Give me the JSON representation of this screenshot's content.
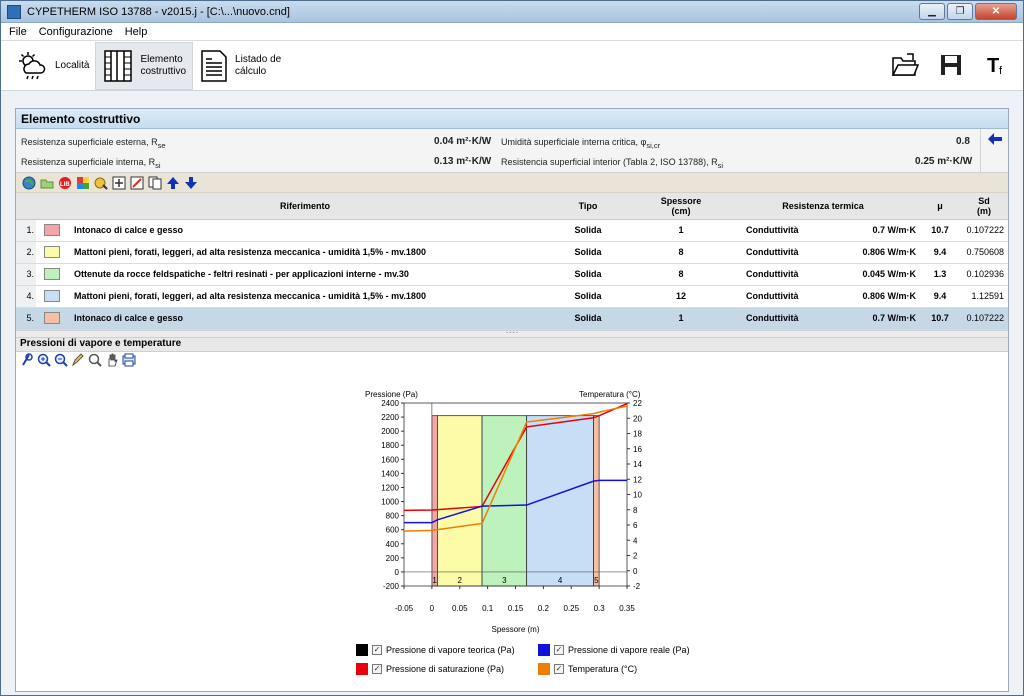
{
  "window": {
    "title": "CYPETHERM ISO 13788 - v2015.j - [C:\\...\\nuovo.cnd]"
  },
  "menu": [
    "File",
    "Configurazione",
    "Help"
  ],
  "toolbar": {
    "localita": "Località",
    "elemento_l1": "Elemento",
    "elemento_l2": "costruttivo",
    "listado_l1": "Listado de",
    "listado_l2": "cálculo"
  },
  "section_title": "Elemento costruttivo",
  "props": {
    "rse_label": "Resistenza superficiale esterna, R",
    "rse_sub": "se",
    "rse_value": "0.04 m²·K/W",
    "rsi_label": "Resistenza superficiale interna, R",
    "rsi_sub": "si",
    "rsi_value": "0.13 m²·K/W",
    "umid_label": "Umidità superficiale interna critica, φ",
    "umid_sub": "si,cr",
    "umid_value": "0.8",
    "res_int_label": "Resistencia superficial interior (Tabla 2, ISO 13788), R",
    "res_int_sub": "si",
    "res_int_value": "0.25 m²·K/W"
  },
  "table": {
    "headers": {
      "riferimento": "Riferimento",
      "tipo": "Tipo",
      "spessore": "Spessore",
      "spessore_unit": "(cm)",
      "resistenza": "Resistenza termica",
      "mu": "μ",
      "sd": "Sd",
      "sd_unit": "(m)"
    },
    "rows": [
      {
        "n": "1.",
        "color": "#f4a6a6",
        "ref": "Intonaco di calce e gesso",
        "tipo": "Solida",
        "spessore": "1",
        "res_type": "Conduttività",
        "res_val": "0.7 W/m·K",
        "mu": "10.7",
        "sd": "0.107222"
      },
      {
        "n": "2.",
        "color": "#fcfca8",
        "ref": "Mattoni pieni, forati, leggeri, ad alta resistenza meccanica - umidità 1,5% - mv.1800",
        "tipo": "Solida",
        "spessore": "8",
        "res_type": "Conduttività",
        "res_val": "0.806 W/m·K",
        "mu": "9.4",
        "sd": "0.750608"
      },
      {
        "n": "3.",
        "color": "#bdf2bd",
        "ref": "Ottenute da rocce feldspatiche - feltri resinati - per applicazioni interne - mv.30",
        "tipo": "Solida",
        "spessore": "8",
        "res_type": "Conduttività",
        "res_val": "0.045 W/m·K",
        "mu": "1.3",
        "sd": "0.102936"
      },
      {
        "n": "4.",
        "color": "#c6def6",
        "ref": "Mattoni pieni, forati, leggeri, ad alta resistenza meccanica - umidità 1,5% - mv.1800",
        "tipo": "Solida",
        "spessore": "12",
        "res_type": "Conduttività",
        "res_val": "0.806 W/m·K",
        "mu": "9.4",
        "sd": "1.12591"
      },
      {
        "n": "5.",
        "color": "#f6bfa3",
        "ref": "Intonaco di calce e gesso",
        "tipo": "Solida",
        "spessore": "1",
        "res_type": "Conduttività",
        "res_val": "0.7 W/m·K",
        "mu": "10.7",
        "sd": "0.107222"
      }
    ]
  },
  "graph_title": "Pressioni di vapore e temperature",
  "chart_data": {
    "type": "line",
    "title": "",
    "xlabel": "Spessore (m)",
    "ylabel": "Pressione (Pa)",
    "y2label": "Temperatura (°C)",
    "xlim": [
      -0.05,
      0.35
    ],
    "ylim": [
      -200,
      2400
    ],
    "y2lim": [
      -2,
      22
    ],
    "x_ticks": [
      "-0.05",
      "0",
      "0.05",
      "0.1",
      "0.15",
      "0.2",
      "0.25",
      "0.3",
      "0.35"
    ],
    "y_ticks": [
      "-200",
      "0",
      "200",
      "400",
      "600",
      "800",
      "1000",
      "1200",
      "1400",
      "1600",
      "1800",
      "2000",
      "2200",
      "2400"
    ],
    "y2_ticks": [
      "-2",
      "0",
      "2",
      "4",
      "6",
      "8",
      "10",
      "12",
      "14",
      "16",
      "18",
      "20",
      "22"
    ],
    "layers": [
      {
        "label": "1",
        "x0": 0,
        "x1": 0.01,
        "color": "#f4a6a6"
      },
      {
        "label": "2",
        "x0": 0.01,
        "x1": 0.09,
        "color": "#fcfca8"
      },
      {
        "label": "3",
        "x0": 0.09,
        "x1": 0.17,
        "color": "#bdf2bd"
      },
      {
        "label": "4",
        "x0": 0.17,
        "x1": 0.29,
        "color": "#c6def6"
      },
      {
        "label": "5",
        "x0": 0.29,
        "x1": 0.3,
        "color": "#f6bfa3"
      }
    ],
    "series": [
      {
        "name": "Pressione di saturazione (Pa)",
        "color": "#e8000b",
        "axis": "left",
        "x": [
          -0.05,
          0,
          0.01,
          0.09,
          0.17,
          0.29,
          0.3,
          0.35
        ],
        "y": [
          875,
          880,
          885,
          930,
          2060,
          2190,
          2220,
          2390
        ]
      },
      {
        "name": "Pressione di vapore reale (Pa)",
        "color": "#1010e0",
        "axis": "left",
        "x": [
          -0.05,
          0,
          0.01,
          0.09,
          0.17,
          0.29,
          0.3,
          0.35
        ],
        "y": [
          700,
          700,
          740,
          935,
          950,
          1290,
          1300,
          1300
        ]
      },
      {
        "name": "Temperatura (°C)",
        "color": "#f07d00",
        "axis": "right",
        "x": [
          -0.05,
          0,
          0.01,
          0.09,
          0.17,
          0.29,
          0.3,
          0.35
        ],
        "y": [
          5.2,
          5.3,
          5.4,
          6.2,
          19.5,
          20.6,
          20.8,
          21.6
        ]
      }
    ],
    "legend": [
      {
        "label": "Pressione di vapore teorica (Pa)",
        "color": "#000000"
      },
      {
        "label": "Pressione di vapore reale (Pa)",
        "color": "#1010e0"
      },
      {
        "label": "Pressione di saturazione (Pa)",
        "color": "#e8000b"
      },
      {
        "label": "Temperatura (°C)",
        "color": "#f07d00"
      }
    ]
  }
}
